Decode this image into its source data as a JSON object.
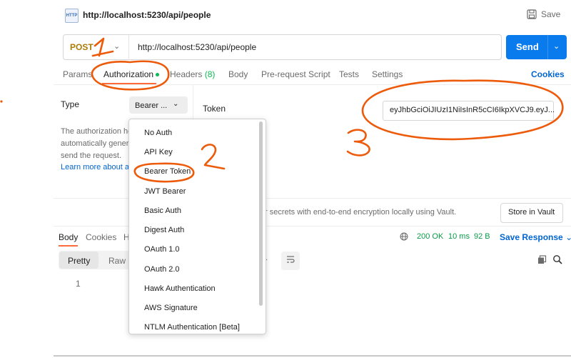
{
  "header": {
    "title": "http://localhost:5230/api/people",
    "save_label": "Save",
    "icon": "http-request-icon",
    "icon_text": "HTTP"
  },
  "request": {
    "method": "POST",
    "url": "http://localhost:5230/api/people",
    "send_label": "Send"
  },
  "tabs": [
    {
      "label": "Params"
    },
    {
      "label": "Authorization"
    },
    {
      "label": "Headers",
      "count": "(8)"
    },
    {
      "label": "Body"
    },
    {
      "label": "Pre-request Script"
    },
    {
      "label": "Tests"
    },
    {
      "label": "Settings"
    }
  ],
  "cookies_label": "Cookies",
  "auth": {
    "type_label": "Type",
    "selected_type": "Bearer ...",
    "description_lines": [
      "The authorization he",
      "automatically gener",
      "send the request."
    ],
    "learn_more": "Learn more about a",
    "token_label": "Token",
    "token_value": "eyJhbGciOiJIUzI1NiIsInR5cCI6IkpXVCJ9.eyJ...",
    "vault_text": "r secrets with end-to-end encryption locally using Vault.",
    "vault_button": "Store in Vault"
  },
  "dropdown": {
    "items": [
      "No Auth",
      "API Key",
      "Bearer Token",
      "JWT Bearer",
      "Basic Auth",
      "Digest Auth",
      "OAuth 1.0",
      "OAuth 2.0",
      "Hawk Authentication",
      "AWS Signature",
      "NTLM Authentication [Beta]"
    ]
  },
  "response": {
    "tabs": [
      "Body",
      "Cookies",
      "H"
    ],
    "status": "200 OK",
    "time": "10 ms",
    "size": "92 B",
    "save_response": "Save Response",
    "view_modes": [
      "Pretty",
      "Raw"
    ],
    "line_number": "1"
  },
  "colors": {
    "accent": "#ff6c37",
    "send": "#097bed",
    "method": "#ad7a03",
    "link": "#0265d2",
    "success": "#0a9a48",
    "annotation": "#ec5a0a"
  }
}
